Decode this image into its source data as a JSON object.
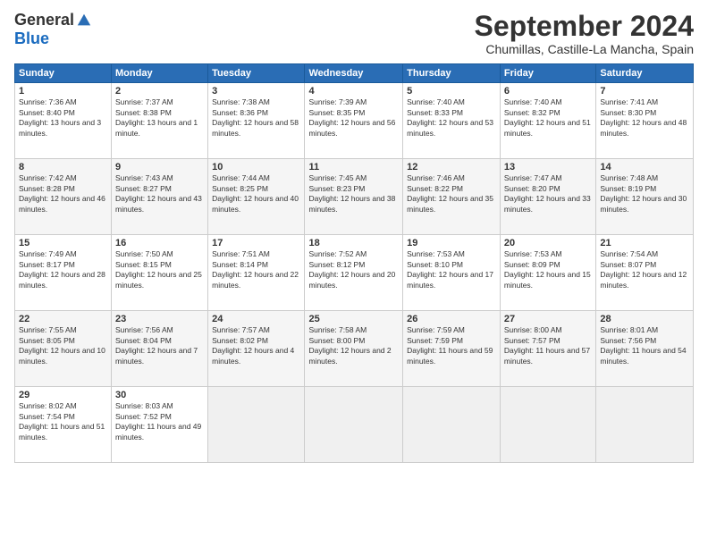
{
  "header": {
    "logo": {
      "general": "General",
      "blue": "Blue"
    },
    "title": "September 2024",
    "location": "Chumillas, Castille-La Mancha, Spain"
  },
  "calendar": {
    "headers": [
      "Sunday",
      "Monday",
      "Tuesday",
      "Wednesday",
      "Thursday",
      "Friday",
      "Saturday"
    ],
    "weeks": [
      [
        null,
        {
          "day": "2",
          "sunrise": "7:37 AM",
          "sunset": "8:38 PM",
          "daylight": "13 hours and 1 minute."
        },
        {
          "day": "3",
          "sunrise": "7:38 AM",
          "sunset": "8:36 PM",
          "daylight": "12 hours and 58 minutes."
        },
        {
          "day": "4",
          "sunrise": "7:39 AM",
          "sunset": "8:35 PM",
          "daylight": "12 hours and 56 minutes."
        },
        {
          "day": "5",
          "sunrise": "7:40 AM",
          "sunset": "8:33 PM",
          "daylight": "12 hours and 53 minutes."
        },
        {
          "day": "6",
          "sunrise": "7:40 AM",
          "sunset": "8:32 PM",
          "daylight": "12 hours and 51 minutes."
        },
        {
          "day": "7",
          "sunrise": "7:41 AM",
          "sunset": "8:30 PM",
          "daylight": "12 hours and 48 minutes."
        }
      ],
      [
        {
          "day": "1",
          "sunrise": "7:36 AM",
          "sunset": "8:40 PM",
          "daylight": "13 hours and 3 minutes."
        },
        {
          "day": "9",
          "sunrise": "7:43 AM",
          "sunset": "8:27 PM",
          "daylight": "12 hours and 43 minutes."
        },
        {
          "day": "10",
          "sunrise": "7:44 AM",
          "sunset": "8:25 PM",
          "daylight": "12 hours and 40 minutes."
        },
        {
          "day": "11",
          "sunrise": "7:45 AM",
          "sunset": "8:23 PM",
          "daylight": "12 hours and 38 minutes."
        },
        {
          "day": "12",
          "sunrise": "7:46 AM",
          "sunset": "8:22 PM",
          "daylight": "12 hours and 35 minutes."
        },
        {
          "day": "13",
          "sunrise": "7:47 AM",
          "sunset": "8:20 PM",
          "daylight": "12 hours and 33 minutes."
        },
        {
          "day": "14",
          "sunrise": "7:48 AM",
          "sunset": "8:19 PM",
          "daylight": "12 hours and 30 minutes."
        }
      ],
      [
        {
          "day": "8",
          "sunrise": "7:42 AM",
          "sunset": "8:28 PM",
          "daylight": "12 hours and 46 minutes."
        },
        {
          "day": "16",
          "sunrise": "7:50 AM",
          "sunset": "8:15 PM",
          "daylight": "12 hours and 25 minutes."
        },
        {
          "day": "17",
          "sunrise": "7:51 AM",
          "sunset": "8:14 PM",
          "daylight": "12 hours and 22 minutes."
        },
        {
          "day": "18",
          "sunrise": "7:52 AM",
          "sunset": "8:12 PM",
          "daylight": "12 hours and 20 minutes."
        },
        {
          "day": "19",
          "sunrise": "7:53 AM",
          "sunset": "8:10 PM",
          "daylight": "12 hours and 17 minutes."
        },
        {
          "day": "20",
          "sunrise": "7:53 AM",
          "sunset": "8:09 PM",
          "daylight": "12 hours and 15 minutes."
        },
        {
          "day": "21",
          "sunrise": "7:54 AM",
          "sunset": "8:07 PM",
          "daylight": "12 hours and 12 minutes."
        }
      ],
      [
        {
          "day": "15",
          "sunrise": "7:49 AM",
          "sunset": "8:17 PM",
          "daylight": "12 hours and 28 minutes."
        },
        {
          "day": "23",
          "sunrise": "7:56 AM",
          "sunset": "8:04 PM",
          "daylight": "12 hours and 7 minutes."
        },
        {
          "day": "24",
          "sunrise": "7:57 AM",
          "sunset": "8:02 PM",
          "daylight": "12 hours and 4 minutes."
        },
        {
          "day": "25",
          "sunrise": "7:58 AM",
          "sunset": "8:00 PM",
          "daylight": "12 hours and 2 minutes."
        },
        {
          "day": "26",
          "sunrise": "7:59 AM",
          "sunset": "7:59 PM",
          "daylight": "11 hours and 59 minutes."
        },
        {
          "day": "27",
          "sunrise": "8:00 AM",
          "sunset": "7:57 PM",
          "daylight": "11 hours and 57 minutes."
        },
        {
          "day": "28",
          "sunrise": "8:01 AM",
          "sunset": "7:56 PM",
          "daylight": "11 hours and 54 minutes."
        }
      ],
      [
        {
          "day": "22",
          "sunrise": "7:55 AM",
          "sunset": "8:05 PM",
          "daylight": "12 hours and 10 minutes."
        },
        {
          "day": "30",
          "sunrise": "8:03 AM",
          "sunset": "7:52 PM",
          "daylight": "11 hours and 49 minutes."
        },
        null,
        null,
        null,
        null,
        null
      ],
      [
        {
          "day": "29",
          "sunrise": "8:02 AM",
          "sunset": "7:54 PM",
          "daylight": "11 hours and 51 minutes."
        },
        null,
        null,
        null,
        null,
        null,
        null
      ]
    ]
  }
}
